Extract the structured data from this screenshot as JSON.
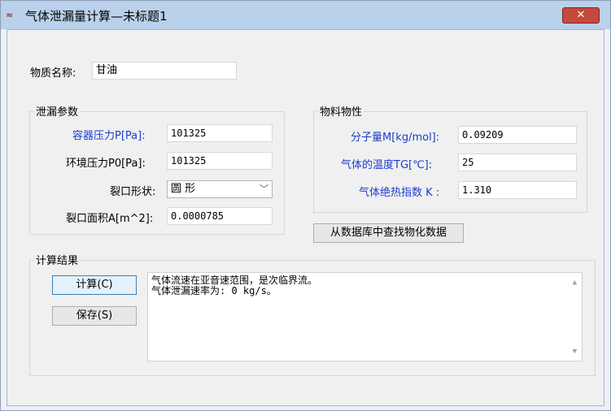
{
  "window": {
    "title": "气体泄漏量计算—未标题1",
    "close": "✕"
  },
  "substance": {
    "label": "物质名称:",
    "value": "甘油"
  },
  "leak_params": {
    "title": "泄漏参数",
    "container_pressure": {
      "label": "容器压力P[Pa]:",
      "value": "101325"
    },
    "ambient_pressure": {
      "label": "环境压力P0[Pa]:",
      "value": "101325"
    },
    "crack_shape": {
      "label": "裂口形状:",
      "value": "圆 形"
    },
    "crack_area": {
      "label": "裂口面积A[m^2]:",
      "value": "0.0000785"
    }
  },
  "material_props": {
    "title": "物料物性",
    "molecular_weight": {
      "label": "分子量M[kg/mol]:",
      "value": "0.09209"
    },
    "gas_temperature": {
      "label": "气体的温度TG[℃]:",
      "value": "25"
    },
    "adiabatic_index": {
      "label": "气体绝热指数",
      "label_k": "K :",
      "value": "1.310"
    }
  },
  "lookup_button": "从数据库中查找物化数据",
  "results": {
    "title": "计算结果",
    "calc_button": "计算(C)",
    "save_button": "保存(S)",
    "lines": [
      "气体流速在亚音速范围，是次临界流。",
      "气体泄漏速率为: 0 kg/s。"
    ]
  },
  "colors": {
    "label_blue": "#1c3ccc",
    "close_red": "#c7483c",
    "titlebar": "#b9d1ea"
  }
}
